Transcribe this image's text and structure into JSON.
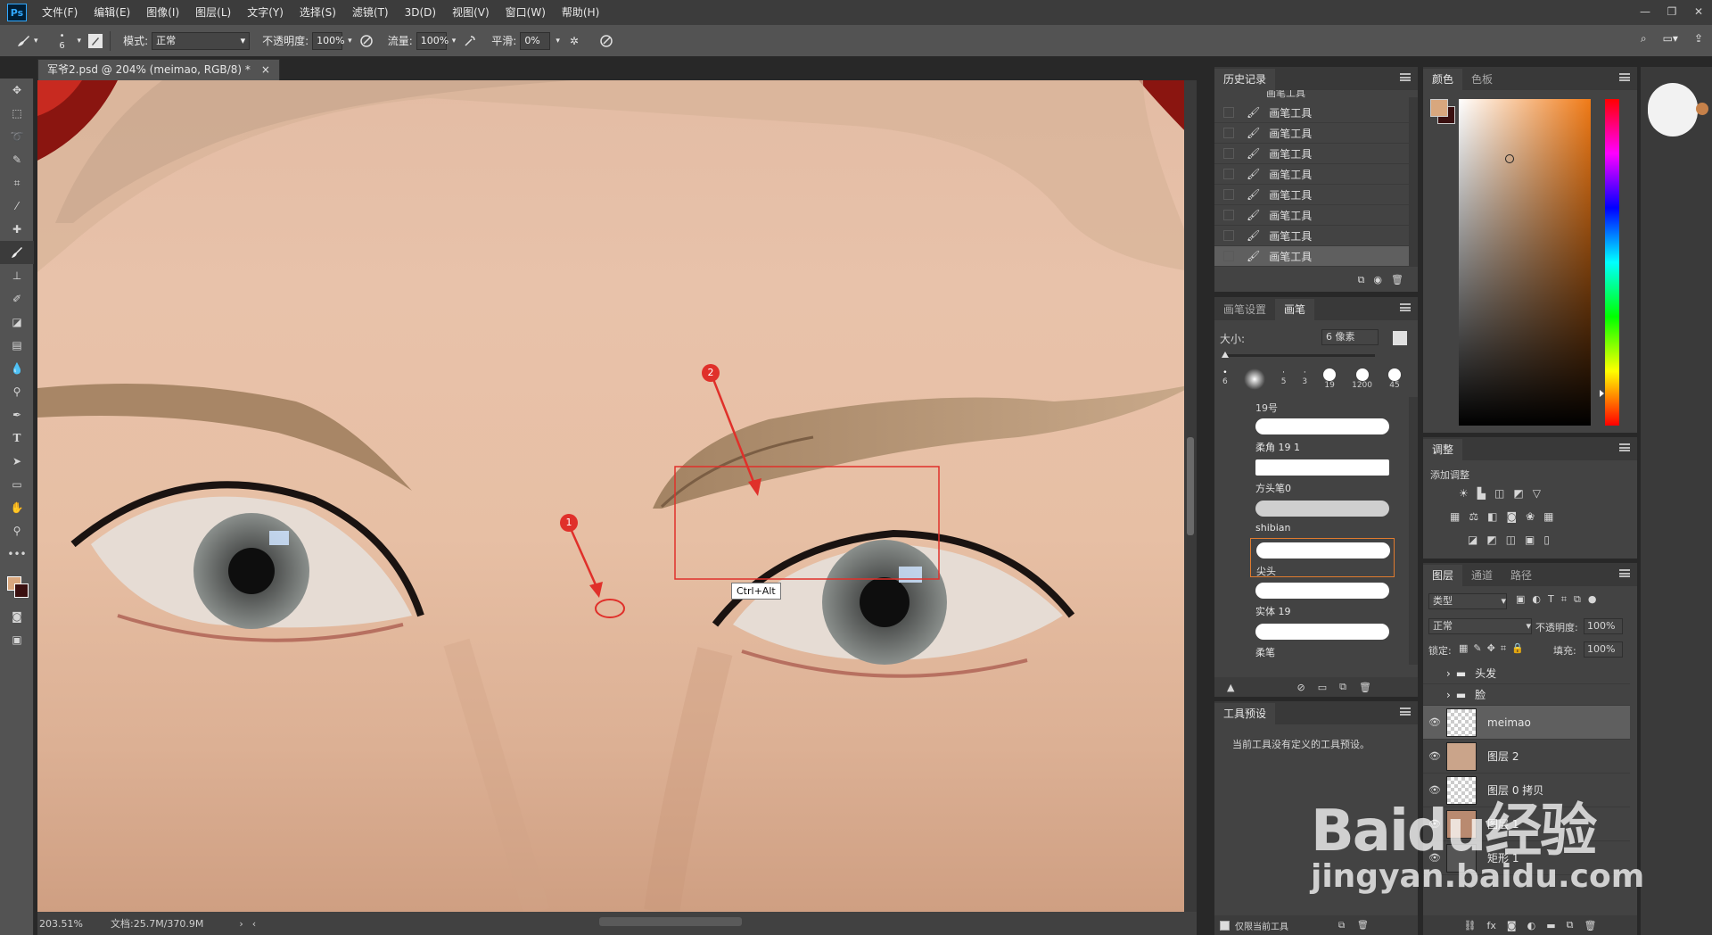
{
  "menubar": {
    "logo": "Ps",
    "items": [
      "文件(F)",
      "编辑(E)",
      "图像(I)",
      "图层(L)",
      "文字(Y)",
      "选择(S)",
      "滤镜(T)",
      "3D(D)",
      "视图(V)",
      "窗口(W)",
      "帮助(H)"
    ]
  },
  "options": {
    "brush_size": "6",
    "mode_label": "模式:",
    "mode_value": "正常",
    "opacity_label": "不透明度:",
    "opacity_value": "100%",
    "flow_label": "流量:",
    "flow_value": "100%",
    "smooth_label": "平滑:",
    "smooth_value": "0%"
  },
  "document": {
    "tab_title": "军爷2.psd @ 204% (meimao, RGB/8) *",
    "tab_close": "×",
    "tooltip": "Ctrl+Alt",
    "callout_1": "1",
    "callout_2": "2",
    "zoom": "203.51%",
    "doc_info": "文档:25.7M/370.9M"
  },
  "history": {
    "title": "历史记录",
    "items": [
      "画笔工具",
      "画笔工具",
      "画笔工具",
      "画笔工具",
      "画笔工具",
      "画笔工具",
      "画笔工具",
      "画笔工具",
      "画笔工具"
    ]
  },
  "brush_panel": {
    "tab_settings": "画笔设置",
    "tab_brush": "画笔",
    "size_label": "大小:",
    "size_value": "6 像素",
    "presets": [
      "6",
      "",
      "5",
      "3",
      "19",
      "1200",
      "45"
    ],
    "group_name": "19号",
    "brushes": [
      "柔角 19 1",
      "方头笔0",
      "shibian",
      "尖头",
      "实体 19",
      "柔笔"
    ]
  },
  "tool_presets": {
    "title": "工具预设",
    "message": "当前工具没有定义的工具预设。",
    "only_current": "仅限当前工具"
  },
  "color_panel": {
    "tab_color": "颜色",
    "tab_swatches": "色板",
    "fg_color": "#d8a77e",
    "bg_color": "#3a1010"
  },
  "adjustments": {
    "title": "调整",
    "add": "添加调整"
  },
  "layers": {
    "tab_layers": "图层",
    "tab_channels": "通道",
    "tab_paths": "路径",
    "filter_kind": "类型",
    "blend_mode": "正常",
    "opacity_label": "不透明度:",
    "opacity_value": "100%",
    "lock_label": "锁定:",
    "fill_label": "填充:",
    "fill_value": "100%",
    "items": [
      "头发",
      "脸",
      "meimao",
      "图层 2",
      "图层 0 拷贝",
      "图层 1",
      "矩形 1"
    ]
  },
  "watermark": {
    "brand": "Baidu经验",
    "url": "jingyan.baidu.com"
  }
}
